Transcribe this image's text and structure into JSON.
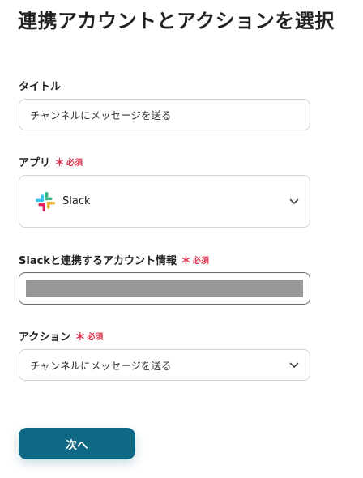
{
  "page": {
    "title": "連携アカウントとアクションを選択"
  },
  "required_mark": "＊",
  "required_text": "必須",
  "fields": {
    "title": {
      "label": "タイトル",
      "value": "チャンネルにメッセージを送る"
    },
    "app": {
      "label": "アプリ",
      "value": "Slack",
      "icon": "slack-logo-icon"
    },
    "account": {
      "label": "Slackと連携するアカウント情報",
      "masked": true
    },
    "action": {
      "label": "アクション",
      "value": "チャンネルにメッセージを送る"
    }
  },
  "buttons": {
    "next_label": "次へ"
  },
  "colors": {
    "accent": "#0f6884",
    "required": "#e0344e",
    "border": "#cfd5db",
    "masked_bar": "#979797"
  }
}
